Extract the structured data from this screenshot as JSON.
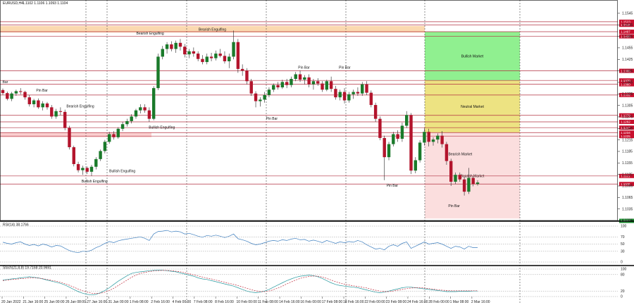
{
  "header": {
    "symbol": "EURUSD,H4",
    "ohlc": "1.1102 1.1106 1.1093 1.1104"
  },
  "chart_data": {
    "type": "candlestick",
    "price_range": [
      1.1005,
      1.1565
    ],
    "y_ticks": [
      "1.1545",
      "1.1515",
      "1.1485",
      "1.1455",
      "1.1425",
      "1.1395",
      "1.1365",
      "1.1335",
      "1.1305",
      "1.1275",
      "1.1245",
      "1.1215",
      "1.1185",
      "1.1155",
      "1.1125",
      "1.1095",
      "1.1065",
      "1.1035",
      "1.1005"
    ],
    "x_labels": [
      "20 Jan 2022",
      "21 Jan 16:00",
      "25 Jan 00:00",
      "26 Jan 08:00",
      "27 Jan 16:00",
      "31 Jan 00:00",
      "1 Feb 08:00",
      "2 Feb 16:00",
      "4 Feb 00:00",
      "7 Feb 08:00",
      "8 Feb 16:00",
      "10 Feb 00:00",
      "11 Feb 08:00",
      "14 Feb 16:00",
      "16 Feb 00:00",
      "17 Feb 08:00",
      "18 Feb 16:00",
      "22 Feb 00:00",
      "23 Feb 08:00",
      "24 Feb 16:00",
      "28 Feb 00:00",
      "1 Mar 08:00",
      "2 Mar 16:00"
    ],
    "levels": [
      {
        "label": "1.1523",
        "price": 1.1523
      },
      {
        "label": "1.1515",
        "price": 1.1515
      },
      {
        "label": "1.1497",
        "price": 1.1497
      },
      {
        "label": "1.1485",
        "price": 1.1485
      },
      {
        "label": "1.1395",
        "price": 1.1395
      },
      {
        "label": "1.1370",
        "price": 1.137
      },
      {
        "label": "1.1360",
        "price": 1.136
      },
      {
        "label": "1.1332",
        "price": 1.1332
      },
      {
        "label": "1.1279",
        "price": 1.1279
      },
      {
        "label": "1.1262",
        "price": 1.1262
      },
      {
        "label": "1.1247",
        "price": 1.1247
      },
      {
        "label": "1.1234",
        "price": 1.1234
      },
      {
        "label": "1.1225",
        "price": 1.1225
      },
      {
        "label": "1.1121",
        "price": 1.1121
      },
      {
        "label": "1.1100",
        "price": 1.11
      }
    ],
    "current_price": {
      "label": "1.1004",
      "price": 1.1004
    },
    "zones": [
      {
        "label": "Bearish Engulfing",
        "from": 1.1495,
        "to": 1.1512,
        "color": "#fbd9b0"
      },
      {
        "label": "Bullish Market",
        "from": 1.137,
        "to": 1.1497,
        "color": "#90f090"
      },
      {
        "label": "Neutral Market",
        "from": 1.1234,
        "to": 1.137,
        "color": "#ede382"
      },
      {
        "label": "Bearish Market",
        "from": 1.101,
        "to": 1.1234,
        "color": "#fbdede"
      }
    ],
    "annotations": [
      {
        "text": "Bearish Engulfing",
        "x": 0.243,
        "price": 1.149
      },
      {
        "text": "Pin Bar",
        "x": 0.068,
        "price": 1.1341
      },
      {
        "text": "Bearish Engulfing",
        "x": 0.13,
        "price": 1.13
      },
      {
        "text": "Bullish Engulfing",
        "x": 0.262,
        "price": 1.1245
      },
      {
        "text": "Bullish Engulfing",
        "x": 0.198,
        "price": 1.1131
      },
      {
        "text": "Bullish Engulfing",
        "x": 0.153,
        "price": 1.1104
      },
      {
        "text": "Pin Bar",
        "x": 0.44,
        "price": 1.1268
      },
      {
        "text": "Pin Bar",
        "x": 0.492,
        "price": 1.1401
      },
      {
        "text": "Pin Bar",
        "x": 0.558,
        "price": 1.1401
      },
      {
        "text": "Pin Bar",
        "x": 0.635,
        "price": 1.1093
      },
      {
        "text": "Bearish Market",
        "x": 0.745,
        "price": 1.1175
      },
      {
        "text": "Pin Bar",
        "x": 0.735,
        "price": 1.104
      },
      {
        "text": "Bar",
        "x": 0.004,
        "price": 1.1363
      }
    ],
    "candles": [
      [
        1.1345,
        1.1349,
        1.1333,
        1.1337
      ],
      [
        1.1337,
        1.1341,
        1.1318,
        1.1322
      ],
      [
        1.1322,
        1.134,
        1.1316,
        1.1336
      ],
      [
        1.1336,
        1.1346,
        1.133,
        1.1342
      ],
      [
        1.1342,
        1.135,
        1.1334,
        1.134
      ],
      [
        1.134,
        1.1343,
        1.132,
        1.1326
      ],
      [
        1.1326,
        1.1332,
        1.1302,
        1.1308
      ],
      [
        1.1308,
        1.1322,
        1.13,
        1.1318
      ],
      [
        1.1318,
        1.1323,
        1.1296,
        1.13
      ],
      [
        1.13,
        1.1316,
        1.1292,
        1.131
      ],
      [
        1.131,
        1.1314,
        1.1294,
        1.13
      ],
      [
        1.13,
        1.1306,
        1.127,
        1.1276
      ],
      [
        1.1276,
        1.1296,
        1.127,
        1.129
      ],
      [
        1.129,
        1.13,
        1.128,
        1.1288
      ],
      [
        1.1288,
        1.1294,
        1.124,
        1.1246
      ],
      [
        1.1246,
        1.1252,
        1.119,
        1.1196
      ],
      [
        1.1196,
        1.12,
        1.1146,
        1.1152
      ],
      [
        1.1152,
        1.1158,
        1.113,
        1.1136
      ],
      [
        1.1136,
        1.1148,
        1.1124,
        1.1142
      ],
      [
        1.1142,
        1.1146,
        1.1126,
        1.1132
      ],
      [
        1.1132,
        1.115,
        1.1121,
        1.1145
      ],
      [
        1.1145,
        1.117,
        1.1138,
        1.1165
      ],
      [
        1.1165,
        1.119,
        1.116,
        1.1186
      ],
      [
        1.1186,
        1.1215,
        1.118,
        1.121
      ],
      [
        1.121,
        1.1236,
        1.1205,
        1.123
      ],
      [
        1.123,
        1.1238,
        1.1216,
        1.1222
      ],
      [
        1.1222,
        1.1248,
        1.1218,
        1.1244
      ],
      [
        1.1244,
        1.1262,
        1.1238,
        1.1256
      ],
      [
        1.1256,
        1.127,
        1.125,
        1.1264
      ],
      [
        1.1264,
        1.1282,
        1.1258,
        1.1276
      ],
      [
        1.1276,
        1.1296,
        1.127,
        1.1292
      ],
      [
        1.1292,
        1.1308,
        1.1284,
        1.13
      ],
      [
        1.13,
        1.1308,
        1.1286,
        1.1292
      ],
      [
        1.1292,
        1.13,
        1.1262,
        1.127
      ],
      [
        1.127,
        1.1355,
        1.1266,
        1.135
      ],
      [
        1.135,
        1.144,
        1.1345,
        1.1432
      ],
      [
        1.1432,
        1.146,
        1.1425,
        1.1452
      ],
      [
        1.1452,
        1.147,
        1.144,
        1.1464
      ],
      [
        1.1464,
        1.1472,
        1.1446,
        1.1452
      ],
      [
        1.1452,
        1.1474,
        1.1442,
        1.1468
      ],
      [
        1.1468,
        1.1478,
        1.1448,
        1.1458
      ],
      [
        1.1458,
        1.1465,
        1.143,
        1.1438
      ],
      [
        1.1438,
        1.1452,
        1.1428,
        1.1446
      ],
      [
        1.1446,
        1.1456,
        1.1432,
        1.144
      ],
      [
        1.144,
        1.1446,
        1.142,
        1.1426
      ],
      [
        1.1426,
        1.1436,
        1.1412,
        1.1418
      ],
      [
        1.1418,
        1.144,
        1.1412,
        1.1432
      ],
      [
        1.1432,
        1.1442,
        1.142,
        1.1428
      ],
      [
        1.1428,
        1.1448,
        1.1422,
        1.144
      ],
      [
        1.144,
        1.1452,
        1.143,
        1.1434
      ],
      [
        1.1434,
        1.1446,
        1.1414,
        1.142
      ],
      [
        1.142,
        1.144,
        1.1402,
        1.1432
      ],
      [
        1.1432,
        1.15,
        1.1425,
        1.147
      ],
      [
        1.147,
        1.1478,
        1.139,
        1.14
      ],
      [
        1.14,
        1.1412,
        1.1382,
        1.1396
      ],
      [
        1.1396,
        1.1402,
        1.136,
        1.1368
      ],
      [
        1.1368,
        1.1374,
        1.133,
        1.1336
      ],
      [
        1.1336,
        1.1342,
        1.13,
        1.1316
      ],
      [
        1.1316,
        1.1326,
        1.1302,
        1.132
      ],
      [
        1.132,
        1.134,
        1.1312,
        1.1332
      ],
      [
        1.1332,
        1.1352,
        1.1326,
        1.1346
      ],
      [
        1.1346,
        1.1362,
        1.134,
        1.1358
      ],
      [
        1.1358,
        1.1366,
        1.1346,
        1.1352
      ],
      [
        1.1352,
        1.1372,
        1.1348,
        1.1366
      ],
      [
        1.1366,
        1.1374,
        1.135,
        1.1358
      ],
      [
        1.1358,
        1.138,
        1.1352,
        1.1374
      ],
      [
        1.1374,
        1.1392,
        1.1368,
        1.1386
      ],
      [
        1.1386,
        1.1396,
        1.1366,
        1.1372
      ],
      [
        1.1372,
        1.1384,
        1.136,
        1.1378
      ],
      [
        1.1378,
        1.1386,
        1.1352,
        1.136
      ],
      [
        1.136,
        1.1374,
        1.1346,
        1.1368
      ],
      [
        1.1368,
        1.1376,
        1.1356,
        1.1362
      ],
      [
        1.1362,
        1.1368,
        1.134,
        1.1346
      ],
      [
        1.1346,
        1.1372,
        1.1342,
        1.1368
      ],
      [
        1.1368,
        1.138,
        1.134,
        1.1348
      ],
      [
        1.1348,
        1.1356,
        1.132,
        1.1326
      ],
      [
        1.1326,
        1.1346,
        1.1318,
        1.134
      ],
      [
        1.134,
        1.135,
        1.131,
        1.1318
      ],
      [
        1.1318,
        1.134,
        1.1312,
        1.1334
      ],
      [
        1.1334,
        1.1346,
        1.1322,
        1.134
      ],
      [
        1.134,
        1.1352,
        1.133,
        1.1336
      ],
      [
        1.1336,
        1.1366,
        1.133,
        1.136
      ],
      [
        1.136,
        1.1368,
        1.1332,
        1.1338
      ],
      [
        1.1338,
        1.1344,
        1.13,
        1.1306
      ],
      [
        1.1306,
        1.1312,
        1.1262,
        1.127
      ],
      [
        1.127,
        1.1276,
        1.1214,
        1.122
      ],
      [
        1.122,
        1.1226,
        1.111,
        1.117
      ],
      [
        1.117,
        1.121,
        1.1162,
        1.1204
      ],
      [
        1.1204,
        1.1236,
        1.1198,
        1.123
      ],
      [
        1.123,
        1.124,
        1.121,
        1.1218
      ],
      [
        1.1218,
        1.126,
        1.121,
        1.1252
      ],
      [
        1.1252,
        1.129,
        1.1246,
        1.128
      ],
      [
        1.128,
        1.1285,
        1.1126,
        1.1135
      ],
      [
        1.1135,
        1.117,
        1.1128,
        1.1162
      ],
      [
        1.1162,
        1.1214,
        1.1156,
        1.1208
      ],
      [
        1.1208,
        1.1246,
        1.12,
        1.1236
      ],
      [
        1.1236,
        1.1244,
        1.1198,
        1.121
      ],
      [
        1.121,
        1.1222,
        1.12,
        1.1216
      ],
      [
        1.1216,
        1.1232,
        1.1206,
        1.1226
      ],
      [
        1.1226,
        1.1238,
        1.1195,
        1.1204
      ],
      [
        1.1204,
        1.121,
        1.115,
        1.116
      ],
      [
        1.116,
        1.1166,
        1.1095,
        1.1106
      ],
      [
        1.1106,
        1.113,
        1.11,
        1.1124
      ],
      [
        1.1124,
        1.113,
        1.1106,
        1.1112
      ],
      [
        1.1112,
        1.112,
        1.107,
        1.108
      ],
      [
        1.108,
        1.1142,
        1.1074,
        1.1116
      ],
      [
        1.1116,
        1.112,
        1.1094,
        1.11
      ],
      [
        1.11,
        1.111,
        1.1096,
        1.1104
      ]
    ],
    "indicators": [
      {
        "name": "RSI(14)",
        "value_text": "38.1766",
        "levels": [
          100,
          70,
          50,
          30,
          0
        ],
        "values": [
          55,
          52,
          50,
          54,
          56,
          50,
          46,
          49,
          45,
          50,
          47,
          42,
          46,
          45,
          38,
          32,
          28,
          26,
          30,
          29,
          33,
          40,
          45,
          52,
          57,
          54,
          59,
          62,
          64,
          66,
          68,
          70,
          66,
          60,
          78,
          85,
          86,
          88,
          84,
          86,
          84,
          78,
          80,
          76,
          72,
          69,
          74,
          72,
          75,
          72,
          68,
          72,
          78,
          65,
          62,
          58,
          52,
          48,
          50,
          54,
          58,
          60,
          58,
          62,
          60,
          64,
          66,
          62,
          63,
          58,
          61,
          58,
          54,
          60,
          56,
          52,
          56,
          54,
          57,
          55,
          60,
          56,
          48,
          42,
          36,
          38,
          34,
          44,
          48,
          44,
          52,
          56,
          38,
          44,
          50,
          56,
          50,
          52,
          54,
          50,
          44,
          38,
          44,
          42,
          36,
          44,
          40,
          40
        ]
      },
      {
        "name": "Stoch(21,8,8)",
        "value_text": "19.7168 20.9691",
        "levels": [
          100,
          80,
          20,
          0
        ],
        "values_main": [
          60,
          62,
          64,
          66,
          68,
          70,
          72,
          70,
          68,
          64,
          60,
          56,
          52,
          48,
          42,
          34,
          26,
          18,
          12,
          8,
          6,
          8,
          14,
          22,
          32,
          44,
          56,
          66,
          76,
          84,
          88,
          90,
          92,
          94,
          95,
          96,
          96,
          94,
          92,
          90,
          86,
          82,
          78,
          74,
          68,
          64,
          62,
          58,
          54,
          50,
          46,
          42,
          38,
          32,
          26,
          20,
          16,
          14,
          16,
          20,
          26,
          34,
          42,
          50,
          58,
          64,
          70,
          74,
          76,
          78,
          76,
          72,
          66,
          58,
          50,
          44,
          40,
          38,
          36,
          34,
          32,
          28,
          24,
          20,
          16,
          14,
          16,
          20,
          24,
          28,
          32,
          34,
          34,
          32,
          30,
          28,
          26,
          24,
          22,
          20,
          18,
          18,
          18,
          19,
          19,
          19,
          20,
          20
        ],
        "values_signal": [
          58,
          60,
          62,
          63,
          65,
          66,
          68,
          68,
          67,
          65,
          62,
          59,
          56,
          52,
          47,
          41,
          34,
          27,
          21,
          16,
          12,
          11,
          12,
          16,
          22,
          30,
          40,
          50,
          60,
          70,
          78,
          84,
          88,
          91,
          93,
          94,
          95,
          95,
          94,
          92,
          90,
          87,
          83,
          79,
          75,
          71,
          67,
          64,
          60,
          56,
          52,
          48,
          44,
          40,
          35,
          30,
          25,
          21,
          18,
          18,
          20,
          25,
          31,
          38,
          46,
          53,
          60,
          66,
          70,
          73,
          75,
          74,
          71,
          66,
          60,
          54,
          49,
          45,
          42,
          39,
          37,
          34,
          31,
          27,
          23,
          20,
          18,
          18,
          20,
          23,
          26,
          29,
          31,
          32,
          32,
          31,
          29,
          27,
          25,
          23,
          22,
          21,
          21,
          21,
          21,
          21,
          21,
          21
        ]
      }
    ]
  }
}
